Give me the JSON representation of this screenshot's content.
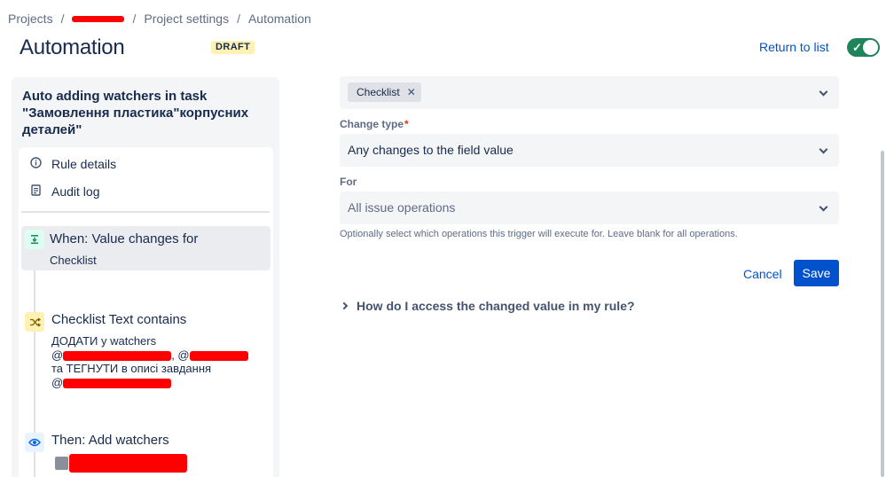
{
  "breadcrumb": {
    "projects": "Projects",
    "separator": "/",
    "project_settings": "Project settings",
    "automation": "Automation"
  },
  "header": {
    "title": "Automation",
    "badge": "DRAFT",
    "return_link": "Return to list",
    "rule_enabled": true
  },
  "sidebar": {
    "rule_name": "Auto adding watchers in task \"Замовлення пластика\"корпусних деталей\"",
    "nav": [
      {
        "label": "Rule details",
        "icon": "info-icon"
      },
      {
        "label": "Audit log",
        "icon": "document-icon"
      }
    ],
    "steps": {
      "when": {
        "title": "When: Value changes for",
        "sub": "Checklist",
        "icon": "trigger-icon"
      },
      "condition": {
        "title": "Checklist Text contains",
        "line1": "ДОДАТИ у watchers",
        "at": "@",
        "comma_at": ", @",
        "line3": "та ТЕГНУТИ в описі завдання",
        "icon": "condition-icon"
      },
      "then": {
        "title": "Then: Add watchers",
        "icon": "eye-icon"
      }
    }
  },
  "form": {
    "fields_tag": "Checklist",
    "change_type_label": "Change type",
    "change_type_value": "Any changes to the field value",
    "for_label": "For",
    "for_placeholder": "All issue operations",
    "helper": "Optionally select which operations this trigger will execute for. Leave blank for all operations.",
    "cancel": "Cancel",
    "save": "Save",
    "expander": "How do I access the changed value in my rule?"
  },
  "colors": {
    "accent": "#0052cc",
    "toggle_on": "#1f845a",
    "draft_badge_bg": "#fff0b3",
    "redaction": "#ff0000"
  }
}
